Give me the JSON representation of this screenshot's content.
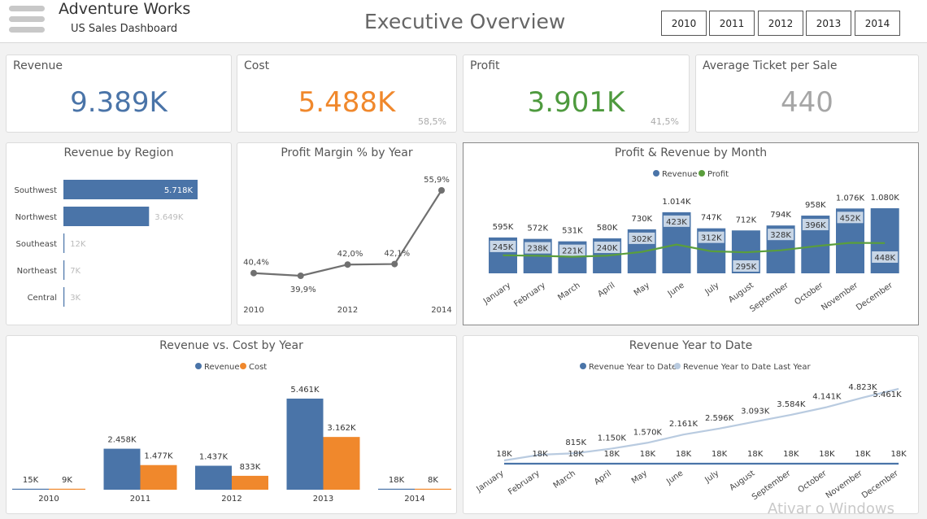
{
  "header": {
    "app_title": "Adventure Works",
    "app_subtitle": "US Sales Dashboard",
    "page_title": "Executive Overview",
    "years": [
      "2010",
      "2011",
      "2012",
      "2013",
      "2014"
    ]
  },
  "kpis": [
    {
      "label": "Revenue",
      "value": "9.389K",
      "pct": "",
      "color": "#4a74a8"
    },
    {
      "label": "Cost",
      "value": "5.488K",
      "pct": "58,5%",
      "color": "#f0882c"
    },
    {
      "label": "Profit",
      "value": "3.901K",
      "pct": "41,5%",
      "color": "#4e9a3e"
    },
    {
      "label": "Average Ticket per Sale",
      "value": "440",
      "pct": "",
      "color": "#a6a6a6"
    }
  ],
  "colors": {
    "blue": "#4a74a8",
    "orange": "#f0882c",
    "green": "#5a9e3c",
    "light_blue": "#c8d6e6",
    "grey_line": "#707070"
  },
  "watermark": "Ativar o Windows",
  "chart_data": [
    {
      "id": "region",
      "type": "bar",
      "title": "Revenue by Region",
      "categories": [
        "Southwest",
        "Northwest",
        "Southeast",
        "Northeast",
        "Central"
      ],
      "values": [
        5718,
        3649,
        12,
        7,
        3
      ],
      "labels": [
        "5.718K",
        "3.649K",
        "12K",
        "7K",
        "3K"
      ]
    },
    {
      "id": "margin",
      "type": "line",
      "title": "Profit Margin % by Year",
      "x": [
        "2010",
        "2011",
        "2012",
        "2013",
        "2014"
      ],
      "x_tick_labels": [
        "2010",
        "",
        "2012",
        "",
        "2014"
      ],
      "values": [
        40.4,
        39.9,
        42.0,
        42.1,
        55.9
      ],
      "labels": [
        "40,4%",
        "39,9%",
        "42,0%",
        "42,1%",
        "55,9%"
      ]
    },
    {
      "id": "month",
      "type": "bar",
      "title": "Profit & Revenue by Month",
      "legend": [
        "Revenue",
        "Profit"
      ],
      "categories": [
        "January",
        "February",
        "March",
        "April",
        "May",
        "June",
        "July",
        "August",
        "September",
        "October",
        "November",
        "December"
      ],
      "series": [
        {
          "name": "Revenue",
          "values": [
            595,
            572,
            531,
            580,
            730,
            1014,
            747,
            712,
            794,
            958,
            1076,
            1080
          ],
          "labels": [
            "595K",
            "572K",
            "531K",
            "580K",
            "730K",
            "1.014K",
            "747K",
            "712K",
            "794K",
            "958K",
            "1.076K",
            "1.080K"
          ]
        },
        {
          "name": "Profit",
          "values": [
            245,
            238,
            221,
            240,
            302,
            423,
            312,
            295,
            328,
            396,
            452,
            448
          ],
          "labels": [
            "245K",
            "238K",
            "221K",
            "240K",
            "302K",
            "423K",
            "312K",
            "295K",
            "328K",
            "396K",
            "452K",
            "448K"
          ]
        }
      ]
    },
    {
      "id": "revcost",
      "type": "bar",
      "title": "Revenue vs. Cost by Year",
      "legend": [
        "Revenue",
        "Cost"
      ],
      "categories": [
        "2010",
        "2011",
        "2012",
        "2013",
        "2014"
      ],
      "series": [
        {
          "name": "Revenue",
          "values": [
            15,
            2458,
            1437,
            5461,
            18
          ],
          "labels": [
            "15K",
            "2.458K",
            "1.437K",
            "5.461K",
            "18K"
          ]
        },
        {
          "name": "Cost",
          "values": [
            9,
            1477,
            833,
            3162,
            8
          ],
          "labels": [
            "9K",
            "1.477K",
            "833K",
            "3.162K",
            "8K"
          ]
        }
      ]
    },
    {
      "id": "ytd",
      "type": "line",
      "title": "Revenue Year to Date",
      "legend": [
        "Revenue Year to Date",
        "Revenue Year to Date Last Year"
      ],
      "categories": [
        "January",
        "February",
        "March",
        "April",
        "May",
        "June",
        "July",
        "August",
        "September",
        "October",
        "November",
        "December"
      ],
      "series": [
        {
          "name": "Revenue Year to Date",
          "values": [
            18,
            18,
            18,
            18,
            18,
            18,
            18,
            18,
            18,
            18,
            18,
            18
          ],
          "labels": [
            "18K",
            "18K",
            "18K",
            "18K",
            "18K",
            "18K",
            "18K",
            "18K",
            "18K",
            "18K",
            "18K",
            "18K"
          ]
        },
        {
          "name": "Revenue Year to Date Last Year",
          "values": [
            null,
            null,
            815,
            1150,
            1570,
            2161,
            2596,
            3093,
            3584,
            4141,
            4823,
            5461
          ],
          "labels": [
            "",
            "",
            "815K",
            "1.150K",
            "1.570K",
            "2.161K",
            "2.596K",
            "3.093K",
            "3.584K",
            "4.141K",
            "4.823K",
            "5.461K"
          ]
        }
      ]
    }
  ]
}
